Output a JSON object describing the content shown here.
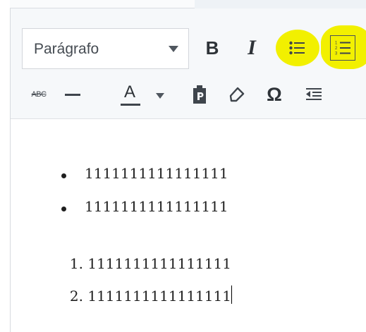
{
  "toolbar": {
    "format_select": {
      "value": "Parágrafo"
    },
    "bold_label": "B",
    "italic_label": "I",
    "strikethrough_label": "ABC",
    "text_color_label": "A",
    "special_char_label": "Ω",
    "highlight_color": "#f2f000",
    "icons": [
      "bulleted-list-icon",
      "numbered-list-icon",
      "horizontal-line-icon",
      "text-color-icon",
      "paste-as-text-icon",
      "clear-formatting-icon",
      "special-character-icon",
      "outdent-icon"
    ]
  },
  "content": {
    "bulleted_list": [
      "1111111111111111",
      "1111111111111111"
    ],
    "numbered_list": [
      {
        "number": "1.",
        "text": "1111111111111111"
      },
      {
        "number": "2.",
        "text": "1111111111111111"
      }
    ]
  }
}
